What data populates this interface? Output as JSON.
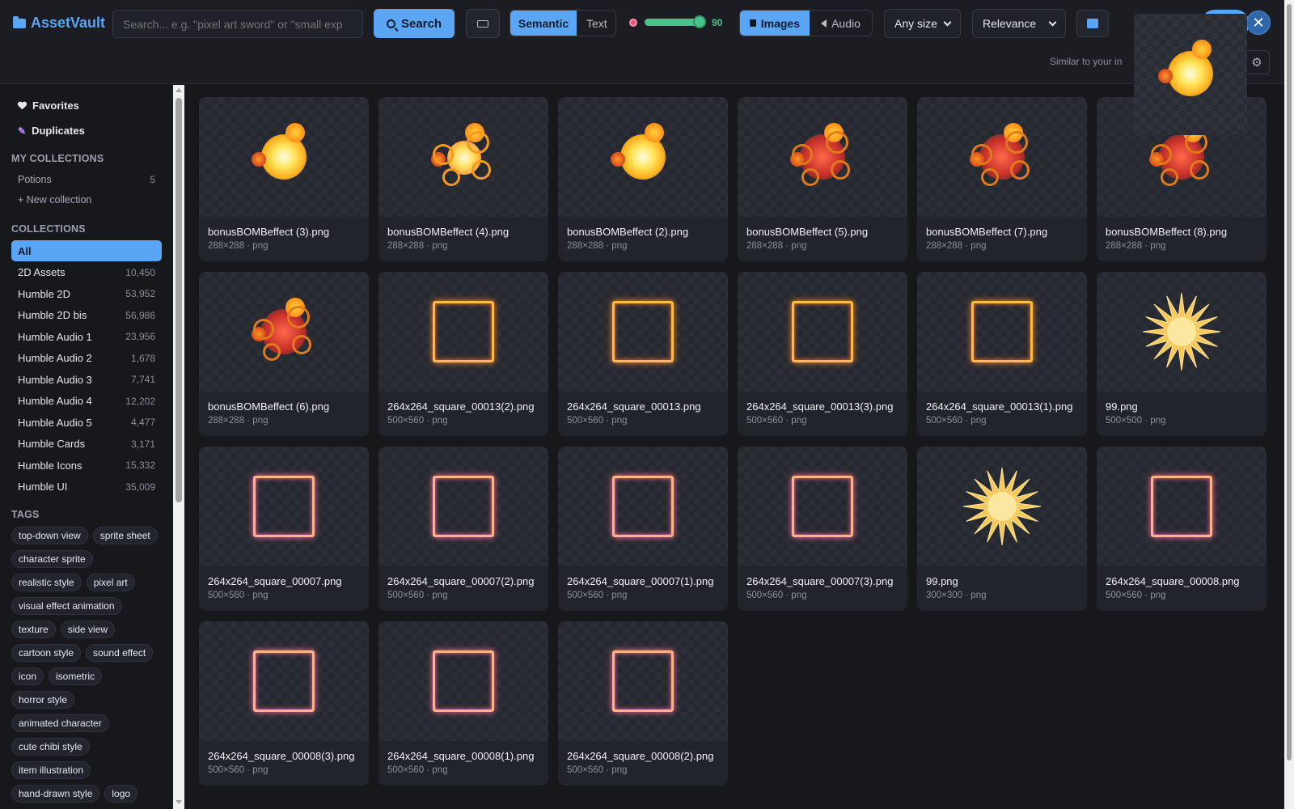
{
  "app": {
    "title": "AssetVault"
  },
  "search": {
    "placeholder": "Search... e.g. \"pixel art sword\" or \"small exp",
    "button_label": "Search"
  },
  "mode": {
    "options": [
      "Semantic",
      "Text"
    ],
    "selected": "Semantic"
  },
  "threshold": {
    "value": "90",
    "fraction": 0.9
  },
  "media_type": {
    "options": [
      "Images",
      "Audio"
    ],
    "selected": "Images"
  },
  "filters": {
    "size": "Any size",
    "sort": "Relevance"
  },
  "similar": {
    "label": "Similar to your in"
  },
  "sidebar": {
    "favorites_label": "Favorites",
    "duplicates_label": "Duplicates",
    "my_collections_heading": "MY COLLECTIONS",
    "my_collections": [
      {
        "label": "Potions",
        "count": "5"
      }
    ],
    "new_collection_label": "+ New collection",
    "collections_heading": "COLLECTIONS",
    "collections": [
      {
        "label": "All",
        "count": ""
      },
      {
        "label": "2D Assets",
        "count": "10,450"
      },
      {
        "label": "Humble 2D",
        "count": "53,952"
      },
      {
        "label": "Humble 2D bis",
        "count": "56,986"
      },
      {
        "label": "Humble Audio 1",
        "count": "23,956"
      },
      {
        "label": "Humble Audio 2",
        "count": "1,678"
      },
      {
        "label": "Humble Audio 3",
        "count": "7,741"
      },
      {
        "label": "Humble Audio 4",
        "count": "12,202"
      },
      {
        "label": "Humble Audio 5",
        "count": "4,477"
      },
      {
        "label": "Humble Cards",
        "count": "3,171"
      },
      {
        "label": "Humble Icons",
        "count": "15,332"
      },
      {
        "label": "Humble UI",
        "count": "35,009"
      }
    ],
    "tags_heading": "TAGS",
    "tags": [
      "top-down view",
      "sprite sheet",
      "character sprite",
      "realistic style",
      "pixel art",
      "visual effect animation",
      "texture",
      "side view",
      "cartoon style",
      "sound effect",
      "icon",
      "isometric",
      "horror style",
      "animated character",
      "cute chibi style",
      "item illustration",
      "hand-drawn style",
      "logo"
    ]
  },
  "results": [
    {
      "name": "bonusBOMBeffect (3).png",
      "meta": "288×288 · png",
      "art": "explosion"
    },
    {
      "name": "bonusBOMBeffect (4).png",
      "meta": "288×288 · png",
      "art": "explosion-v2"
    },
    {
      "name": "bonusBOMBeffect (2).png",
      "meta": "288×288 · png",
      "art": "explosion"
    },
    {
      "name": "bonusBOMBeffect (5).png",
      "meta": "288×288 · png",
      "art": "explosion-rings"
    },
    {
      "name": "bonusBOMBeffect (7).png",
      "meta": "288×288 · png",
      "art": "explosion-rings"
    },
    {
      "name": "bonusBOMBeffect (8).png",
      "meta": "288×288 · png",
      "art": "explosion-rings"
    },
    {
      "name": "bonusBOMBeffect (6).png",
      "meta": "288×288 · png",
      "art": "explosion-rings"
    },
    {
      "name": "264x264_square_00013(2).png",
      "meta": "500×560 · png",
      "art": "frame"
    },
    {
      "name": "264x264_square_00013.png",
      "meta": "500×560 · png",
      "art": "frame"
    },
    {
      "name": "264x264_square_00013(3).png",
      "meta": "500×560 · png",
      "art": "frame"
    },
    {
      "name": "264x264_square_00013(1).png",
      "meta": "500×560 · png",
      "art": "frame"
    },
    {
      "name": "99.png",
      "meta": "500×500 · png",
      "art": "burst"
    },
    {
      "name": "264x264_square_00007.png",
      "meta": "500×560 · png",
      "art": "frame-pink"
    },
    {
      "name": "264x264_square_00007(2).png",
      "meta": "500×560 · png",
      "art": "frame-pink"
    },
    {
      "name": "264x264_square_00007(1).png",
      "meta": "500×560 · png",
      "art": "frame-pink"
    },
    {
      "name": "264x264_square_00007(3).png",
      "meta": "500×560 · png",
      "art": "frame-pink"
    },
    {
      "name": "99.png",
      "meta": "300×300 · png",
      "art": "burst"
    },
    {
      "name": "264x264_square_00008.png",
      "meta": "500×560 · png",
      "art": "frame-pink"
    },
    {
      "name": "264x264_square_00008(3).png",
      "meta": "500×560 · png",
      "art": "frame-pink"
    },
    {
      "name": "264x264_square_00008(1).png",
      "meta": "500×560 · png",
      "art": "frame-pink"
    },
    {
      "name": "264x264_square_00008(2).png",
      "meta": "500×560 · png",
      "art": "frame-pink"
    }
  ],
  "colors": {
    "accent": "#5aa6f5",
    "success": "#48c48a",
    "background": "#17181c"
  }
}
